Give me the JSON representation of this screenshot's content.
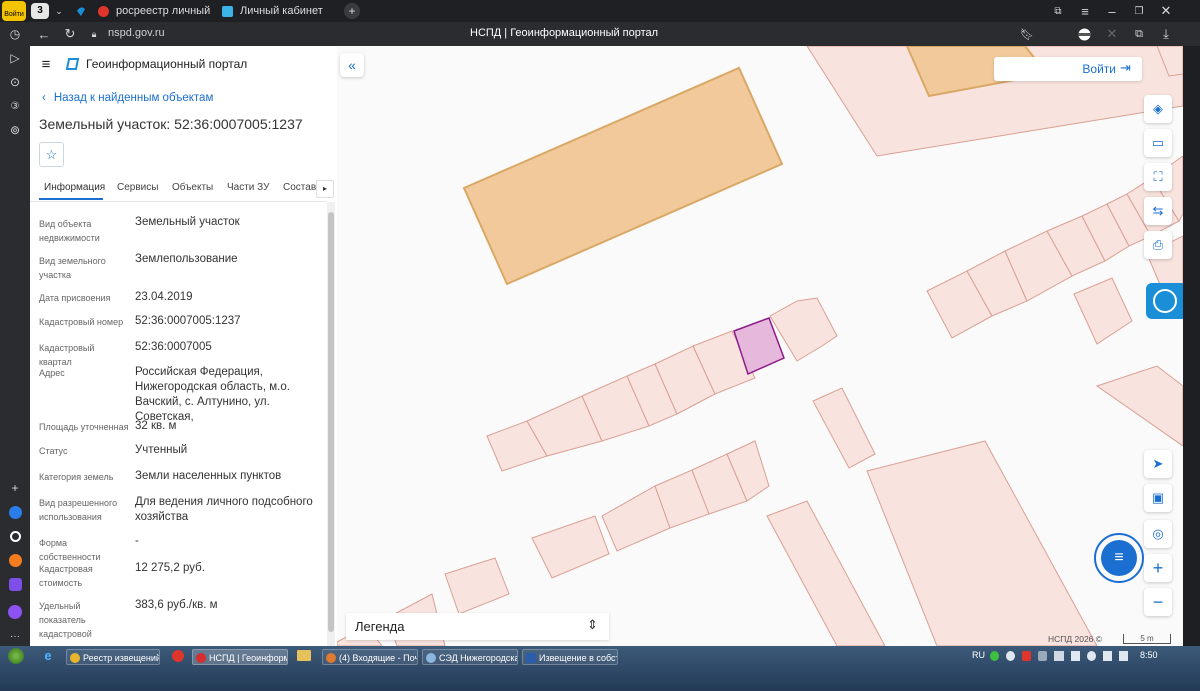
{
  "browser": {
    "tab_counter": "3",
    "tabs": [
      {
        "label": "росреестр личный кабин"
      },
      {
        "label": "Личный кабинет"
      }
    ],
    "address": "nspd.gov.ru",
    "page_title": "НСПД | Геоинформационный портал",
    "login_badge": "Войти"
  },
  "app": {
    "title": "Геоинформационный портал",
    "back_link": "Назад к найденным объектам",
    "heading": "Земельный участок: 52:36:0007005:1237",
    "tabs": [
      "Информация",
      "Сервисы",
      "Объекты",
      "Части ЗУ",
      "Состав"
    ],
    "rows": [
      {
        "label": "Вид объекта недвижимости",
        "value": "Земельный участок"
      },
      {
        "label": "Вид земельного участка",
        "value": "Землепользование"
      },
      {
        "label": "Дата присвоения",
        "value": "23.04.2019"
      },
      {
        "label": "Кадастровый номер",
        "value": "52:36:0007005:1237"
      },
      {
        "label": "Кадастровый квартал",
        "value": "52:36:0007005"
      },
      {
        "label": "Адрес",
        "value": "Российская Федерация, Нижегородская область, м.о. Вачский, с. Алтунино, ул. Советская,"
      },
      {
        "label": "Площадь уточненная",
        "value": "32 кв. м"
      },
      {
        "label": "Статус",
        "value": "Учтенный"
      },
      {
        "label": "Категория земель",
        "value": "Земли населенных пунктов"
      },
      {
        "label": "Вид разрешенного использования",
        "value": "Для ведения личного подсобного хозяйства"
      },
      {
        "label": "Форма собственности",
        "value": "-"
      },
      {
        "label": "Кадастровая стоимость",
        "value": "12 275,2 руб."
      },
      {
        "label": "Удельный показатель кадастровой стоимости",
        "value": "383,6 руб./кв. м"
      }
    ]
  },
  "map": {
    "login": "Войти",
    "legend": "Легенда",
    "copyright": "НСПД 2026 ©",
    "scale": "5 m",
    "colors": {
      "parcel_fill": "#f7e1dc",
      "parcel_stroke": "#d9a59a",
      "building": "#f2c99a",
      "selected": "#e4b5d9",
      "selected_stroke": "#8b1c8b",
      "accent": "#1a6fd1"
    }
  },
  "taskbar": {
    "items": [
      {
        "label": "Реестр извещений -..."
      },
      {
        "label": ""
      },
      {
        "label": "НСПД | Геоинформ..."
      },
      {
        "label": ""
      },
      {
        "label": "(4) Входящие - Почт..."
      },
      {
        "label": "СЭД Нижегородска..."
      },
      {
        "label": "Извещение в собст..."
      }
    ],
    "lang": "RU",
    "time": "8:50"
  }
}
